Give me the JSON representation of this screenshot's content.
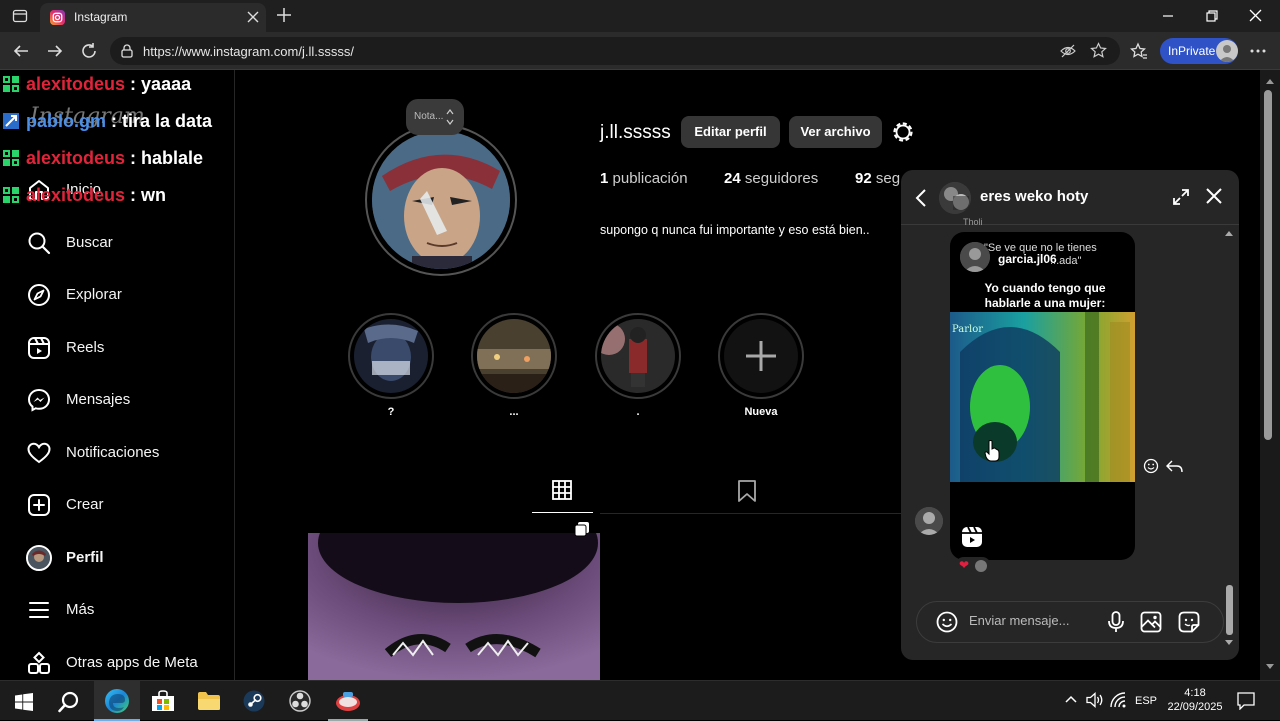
{
  "browser": {
    "tab_title": "Instagram",
    "url": "https://www.instagram.com/j.ll.sssss/",
    "inprivate_label": "InPrivate"
  },
  "chat_overlay": [
    {
      "user": "alexitodeus",
      "msg": " : yaaaa",
      "color": "#e0243a"
    },
    {
      "user": "pablo.gm",
      "msg": " : tira la data",
      "color": "#4a8fe8"
    },
    {
      "user": "alexitodeus",
      "msg": " : hablale",
      "color": "#e0243a"
    },
    {
      "user": "alexitodeus",
      "msg": " : wn",
      "color": "#e0243a"
    }
  ],
  "sidebar": {
    "brand": "Instagram",
    "items": [
      {
        "label": "Inicio",
        "icon": "home-icon"
      },
      {
        "label": "Buscar",
        "icon": "search-icon"
      },
      {
        "label": "Explorar",
        "icon": "compass-icon"
      },
      {
        "label": "Reels",
        "icon": "reels-icon"
      },
      {
        "label": "Mensajes",
        "icon": "messenger-icon"
      },
      {
        "label": "Notificaciones",
        "icon": "heart-icon"
      },
      {
        "label": "Crear",
        "icon": "plus-square-icon"
      },
      {
        "label": "Perfil",
        "icon": "avatar-icon"
      },
      {
        "label": "Más",
        "icon": "menu-icon"
      },
      {
        "label": "Otras apps de Meta",
        "icon": "apps-icon"
      }
    ]
  },
  "profile": {
    "note_label": "Nota...",
    "username": "j.ll.sssss",
    "edit_button": "Editar perfil",
    "archive_button": "Ver archivo",
    "stats": [
      {
        "num": "1",
        "label": " publicación"
      },
      {
        "num": "24",
        "label": " seguidores"
      },
      {
        "num": "92",
        "label": " seg"
      }
    ],
    "bio": "supongo q nunca fui importante y eso está bien..",
    "highlights": [
      {
        "label": "?"
      },
      {
        "label": "..."
      },
      {
        "label": "."
      },
      {
        "label": "Nueva"
      }
    ]
  },
  "dm": {
    "title": "eres weko hoty",
    "header_fragment": "Tholi",
    "reel_user": "garcia.jl06",
    "reel_top_text": "\"Se ve que no le tienes",
    "reel_top_text2": "...ada\"",
    "reel_caption": "Yo cuando tengo que hablarle a una mujer:",
    "reel_watermark": "Parlor",
    "reaction_emoji": "❤",
    "input_placeholder": "Enviar mensaje..."
  },
  "taskbar": {
    "lang": "ESP",
    "time": "4:18",
    "date": "22/09/2025"
  },
  "colors": {
    "accent": "#0095f6",
    "inprivate": "#2f53c7",
    "chat_red": "#e0243a",
    "chat_blue": "#4a8fe8"
  }
}
